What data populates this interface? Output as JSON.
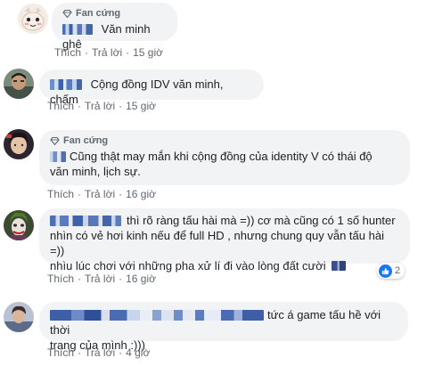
{
  "fan_label": "Fan cứng",
  "actions": {
    "like": "Thích",
    "reply": "Trả lời",
    "dot": "·"
  },
  "colors": {
    "bubble": "#f2f3f5",
    "meta": "#606770",
    "like_blue": "#1877f2"
  },
  "comments": [
    {
      "has_fan_badge": true,
      "text": "Văn minh ghê",
      "time": "15 giờ",
      "avatar_icon": "cartoon-face-avatar"
    },
    {
      "has_fan_badge": false,
      "text": "Cộng đồng IDV văn minh, chấm",
      "time": "15 giờ",
      "avatar_icon": "photo-avatar"
    },
    {
      "has_fan_badge": true,
      "text_line1": "Cũng thật may mắn khi cộng đồng của identity V có thái độ",
      "text_line2": "văn minh, lịch sự.",
      "time": "16 giờ",
      "avatar_icon": "photo-avatar"
    },
    {
      "has_fan_badge": false,
      "text_line1": "thì rõ ràng tấu hài mà =)) cơ mà cũng có 1 số hunter",
      "text_line2": "nhìn có vẻ hơi kinh nếu để full HD , nhưng chung quy vẫn tấu hài =))",
      "text_line3": "nhìu lúc chơi với những pha xử lí đi vào lòng đất cười",
      "time": "16 giờ",
      "reaction_count": "2",
      "avatar_icon": "joker-avatar"
    },
    {
      "has_fan_badge": false,
      "text_line1": "tức á game tấu hề với thời",
      "text_line2": "trang của mình :)))",
      "time": "4 giờ",
      "avatar_icon": "photo-avatar"
    }
  ]
}
